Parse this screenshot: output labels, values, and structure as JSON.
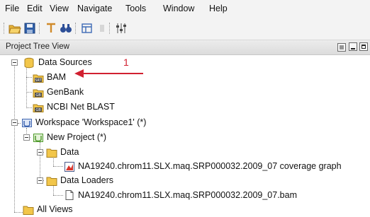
{
  "menu": [
    "File",
    "Edit",
    "View",
    "Navigate",
    "Tools",
    "Window",
    "Help"
  ],
  "toolbar": {
    "icons": [
      "open-folder-icon",
      "save-icon",
      "filter-icon",
      "search-binoculars-icon",
      "layout-icon",
      "disabled-icon",
      "settings-icon"
    ]
  },
  "panel": {
    "title": "Project Tree View"
  },
  "tree": {
    "data_sources": "Data Sources",
    "bam": "BAM",
    "genbank": "GenBank",
    "ncbi": "NCBI Net BLAST",
    "workspace": "Workspace 'Workspace1' (*)",
    "new_project": "New Project (*)",
    "data": "Data",
    "coverage_graph": "NA19240.chrom11.SLX.maq.SRP000032.2009_07 coverage graph",
    "data_loaders": "Data Loaders",
    "bam_file": "NA19240.chrom11.SLX.maq.SRP000032.2009_07.bam",
    "all_views": "All Views"
  },
  "annotation": {
    "label": "1",
    "color": "#d12030"
  }
}
